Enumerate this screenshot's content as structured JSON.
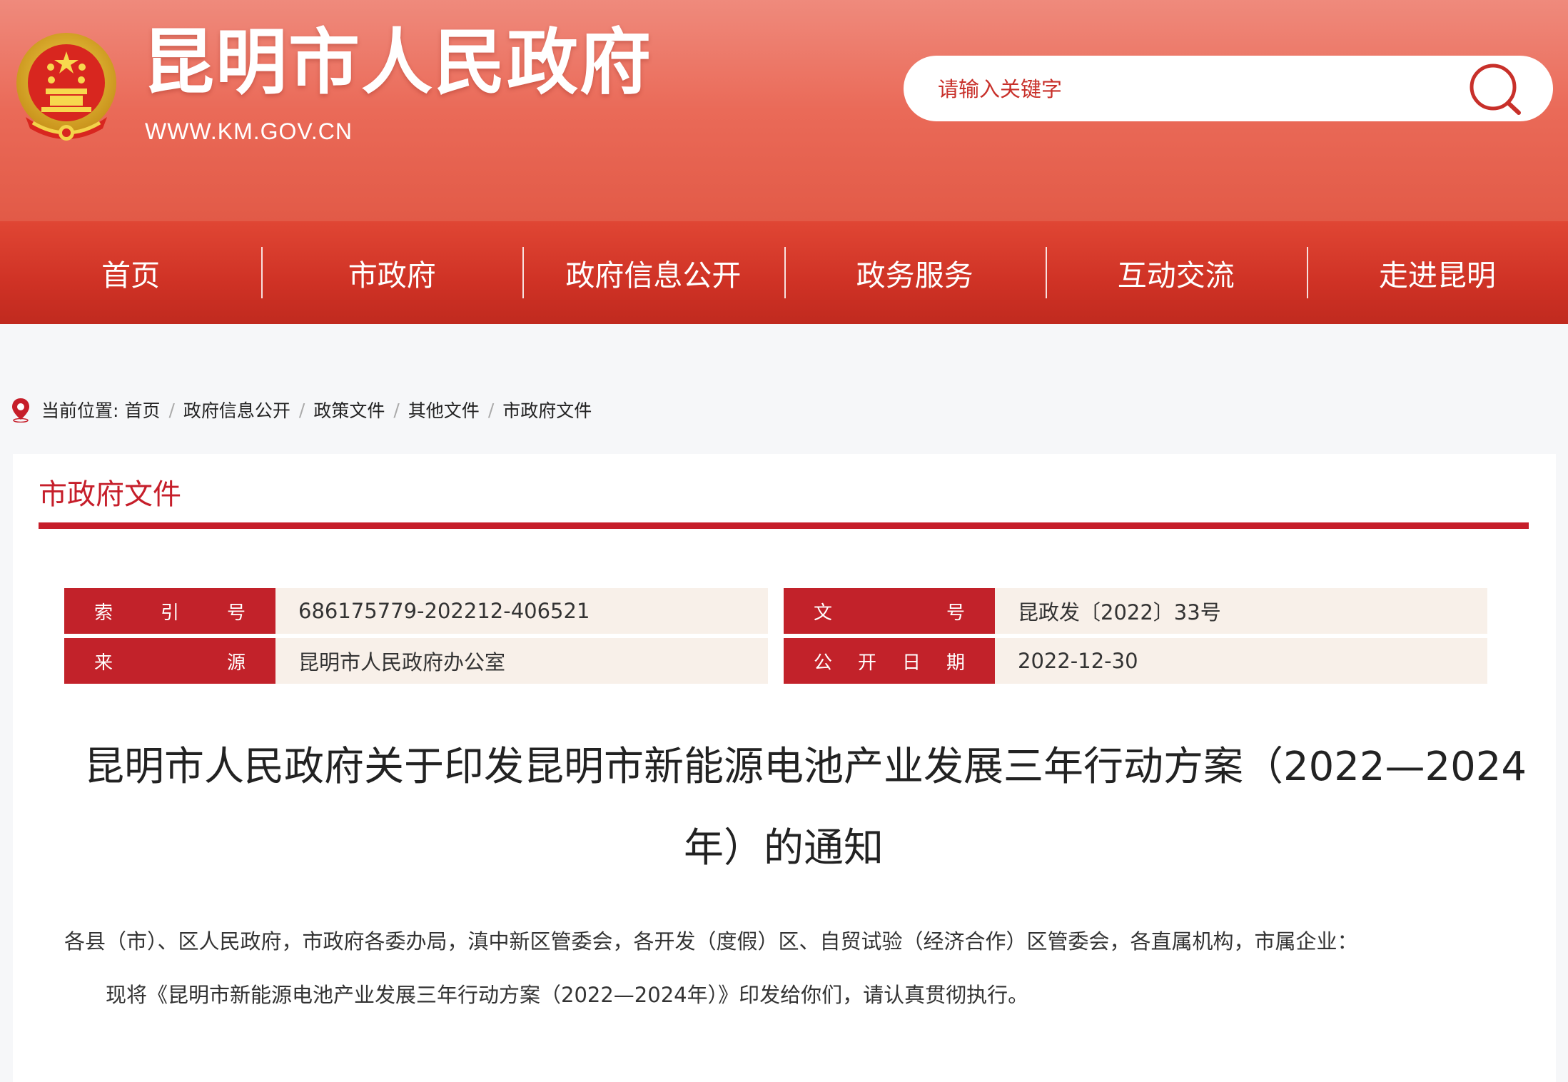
{
  "header": {
    "site_title": "昆明市人民政府",
    "site_url": "WWW.KM.GOV.CN",
    "search_placeholder": "请输入关键字"
  },
  "nav": {
    "items": [
      "首页",
      "市政府",
      "政府信息公开",
      "政务服务",
      "互动交流",
      "走进昆明"
    ]
  },
  "breadcrumb": {
    "label": "当前位置:",
    "items": [
      "首页",
      "政府信息公开",
      "政策文件",
      "其他文件",
      "市政府文件"
    ],
    "separator": "/"
  },
  "section": {
    "title": "市政府文件"
  },
  "meta": {
    "index_label": "索引号",
    "index_value": "686175779-202212-406521",
    "doc_no_label": "文号",
    "doc_no_value": "昆政发〔2022〕33号",
    "source_label": "来源",
    "source_value": "昆明市人民政府办公室",
    "date_label": "公开日期",
    "date_value": "2022-12-30"
  },
  "document": {
    "title_line1": "昆明市人民政府关于印发昆明市新能源电池产业发展三年行动方案（2022—2024",
    "title_line2": "年）的通知",
    "salutation": "各县（市）、区人民政府，市政府各委办局，滇中新区管委会，各开发（度假）区、自贸试验（经济合作）区管委会，各直属机构，市属企业：",
    "paragraph1": "现将《昆明市新能源电池产业发展三年行动方案（2022—2024年）》印发给你们，请认真贯彻执行。"
  },
  "colors": {
    "brand_red": "#c61e2a",
    "header_top": "#ef8a7c",
    "nav_red": "#cf3225",
    "meta_bg": "#f8f0e9"
  },
  "icons": {
    "emblem": "national-emblem-icon",
    "search": "search-icon",
    "location": "location-pin-icon"
  }
}
